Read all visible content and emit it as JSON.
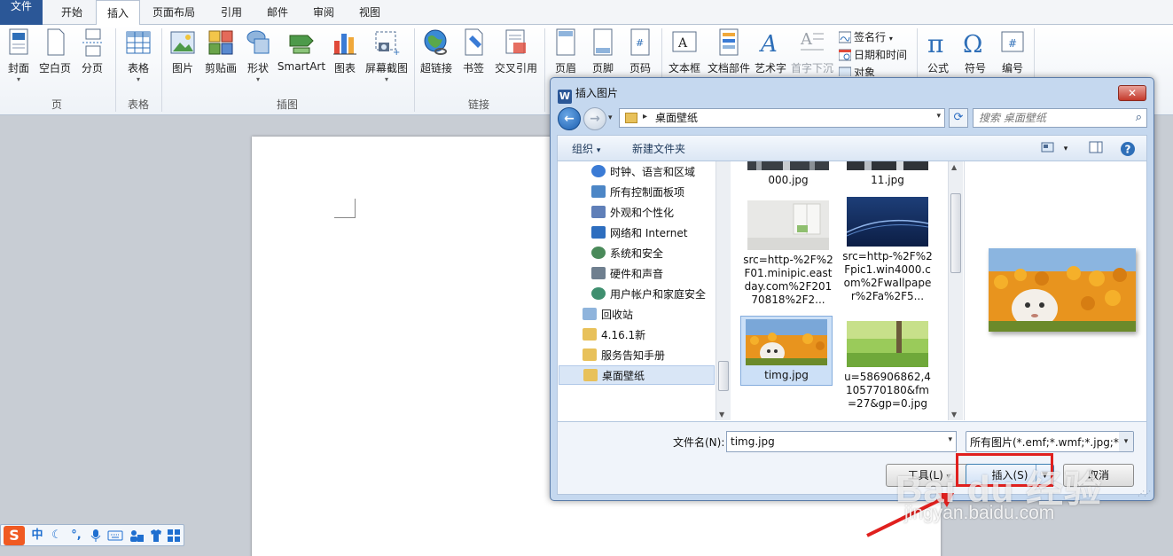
{
  "ribbon": {
    "tabs": [
      "文件",
      "开始",
      "插入",
      "页面布局",
      "引用",
      "邮件",
      "审阅",
      "视图"
    ],
    "active_tab": "插入",
    "groups": {
      "page": {
        "label": "页",
        "buttons": [
          "封面",
          "空白页",
          "分页"
        ]
      },
      "table": {
        "label": "表格",
        "buttons": [
          "表格"
        ]
      },
      "illustrations": {
        "label": "插图",
        "buttons": [
          "图片",
          "剪贴画",
          "形状",
          "SmartArt",
          "图表",
          "屏幕截图"
        ]
      },
      "links": {
        "label": "链接",
        "buttons": [
          "超链接",
          "书签",
          "交叉引用"
        ]
      },
      "header_footer": {
        "buttons": [
          "页眉",
          "页脚",
          "页码"
        ]
      },
      "text": {
        "buttons": [
          "文本框",
          "文档部件",
          "艺术字",
          "首字下沉"
        ],
        "small": [
          "签名行",
          "日期和时间",
          "对象"
        ]
      },
      "symbols": {
        "buttons": [
          "公式",
          "符号",
          "编号"
        ]
      }
    }
  },
  "dialog": {
    "title": "插入图片",
    "app_icon_letter": "W",
    "close_label": "✕",
    "address_path": "桌面壁纸",
    "search_placeholder": "搜索 桌面壁纸",
    "toolbar": {
      "organize": "组织",
      "new_folder": "新建文件夹"
    },
    "tree": [
      {
        "label": "时钟、语言和区域",
        "icon_color": "#3a7bd5"
      },
      {
        "label": "所有控制面板项",
        "icon_color": "#4c86c6"
      },
      {
        "label": "外观和个性化",
        "icon_color": "#5f7fb8"
      },
      {
        "label": "网络和 Internet",
        "icon_color": "#2e6ebf"
      },
      {
        "label": "系统和安全",
        "icon_color": "#4a8a5a"
      },
      {
        "label": "硬件和声音",
        "icon_color": "#6f7f8f"
      },
      {
        "label": "用户帐户和家庭安全",
        "icon_color": "#3f8f6f"
      },
      {
        "label": "回收站",
        "icon_color": "#8fb4dc"
      },
      {
        "label": "4.16.1新",
        "icon_color": "#e8c15a"
      },
      {
        "label": "服务告知手册",
        "icon_color": "#e8c15a"
      },
      {
        "label": "桌面壁纸",
        "icon_color": "#e8c15a"
      }
    ],
    "selected_tree_item": "桌面壁纸",
    "files": [
      {
        "name": "000.jpg"
      },
      {
        "name": "11.jpg"
      },
      {
        "name": "src=http-%2F%2F01.minipic.eastday.com%2F20170818%2F2..."
      },
      {
        "name": "src=http-%2F%2Fpic1.win4000.com%2Fwallpaper%2Fa%2F5..."
      },
      {
        "name": "timg.jpg"
      },
      {
        "name": "u=586906862,4105770180&fm=27&gp=0.jpg"
      }
    ],
    "selected_file": "timg.jpg",
    "filename_label": "文件名(N):",
    "filename_value": "timg.jpg",
    "filetype_value": "所有图片(*.emf;*.wmf;*.jpg;*.jp",
    "tools_label": "工具(L)",
    "insert_label": "插入(S)",
    "cancel_label": "取消"
  },
  "ime": {
    "logo": "S",
    "items": [
      "中",
      "☾",
      "°,",
      "🎤",
      "⌨",
      "👥",
      "👕",
      "▦"
    ]
  },
  "watermark": {
    "brand": "Bai du 经验",
    "url": "jingyan.baidu.com"
  },
  "colors": {
    "file_tab": "#2b5797",
    "dialog_frame": "#c5d8ef",
    "highlight": "#e0201e"
  }
}
